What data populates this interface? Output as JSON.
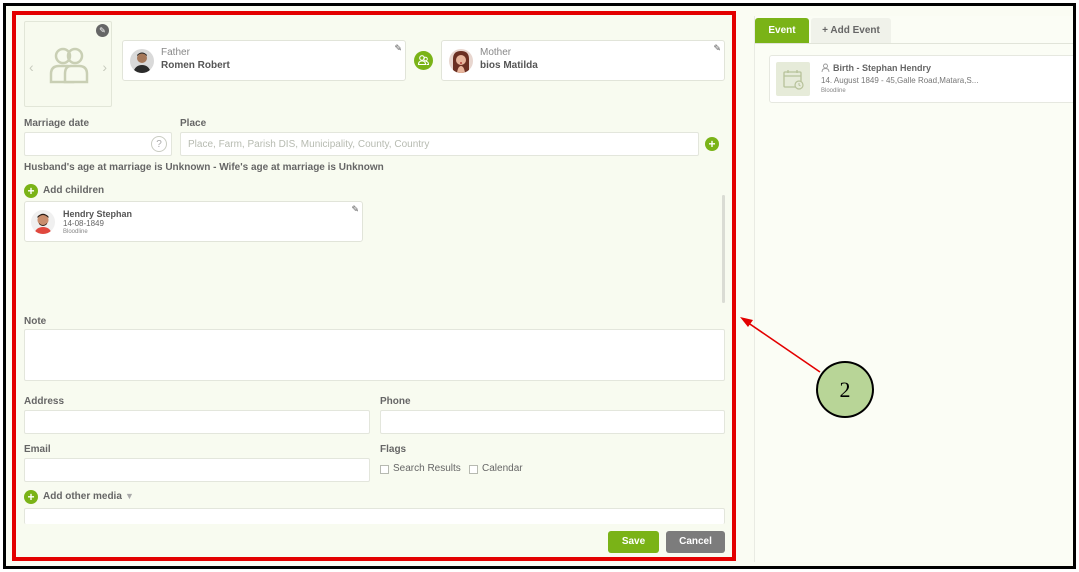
{
  "form": {
    "father": {
      "role": "Father",
      "name": "Romen Robert"
    },
    "mother": {
      "role": "Mother",
      "name": "bios Matilda"
    },
    "marriage_date_label": "Marriage date",
    "place_label": "Place",
    "place_placeholder": "Place, Farm, Parish DIS, Municipality, County, Country",
    "help_glyph": "?",
    "age_text": "Husband's age at marriage is Unknown - Wife's age at marriage is Unknown",
    "add_children_label": "Add children",
    "child": {
      "name": "Hendry Stephan",
      "date": "14-08-1849",
      "line": "Bloodline"
    },
    "note_label": "Note",
    "address_label": "Address",
    "phone_label": "Phone",
    "email_label": "Email",
    "flags_label": "Flags",
    "flags": {
      "search_results": "Search Results",
      "calendar": "Calendar"
    },
    "add_media_label": "Add other media",
    "save_label": "Save",
    "cancel_label": "Cancel"
  },
  "event_panel": {
    "tabs": {
      "active": "Event",
      "inactive": "+ Add Event"
    },
    "event": {
      "title": "Birth - Stephan Hendry",
      "description": "14. August 1849 - 45,Galle Road,Matara,S...",
      "line": "Bloodline"
    }
  },
  "annotation": {
    "number": "2"
  },
  "colors": {
    "accent": "#7ab317",
    "highlight": "#e30000",
    "annotation_fill": "#b8d597"
  },
  "icons": [
    "edit-icon",
    "family-placeholder-icon",
    "couple-icon",
    "help-icon",
    "plus-icon",
    "calendar-icon",
    "person-icon",
    "chevron-down-icon"
  ]
}
